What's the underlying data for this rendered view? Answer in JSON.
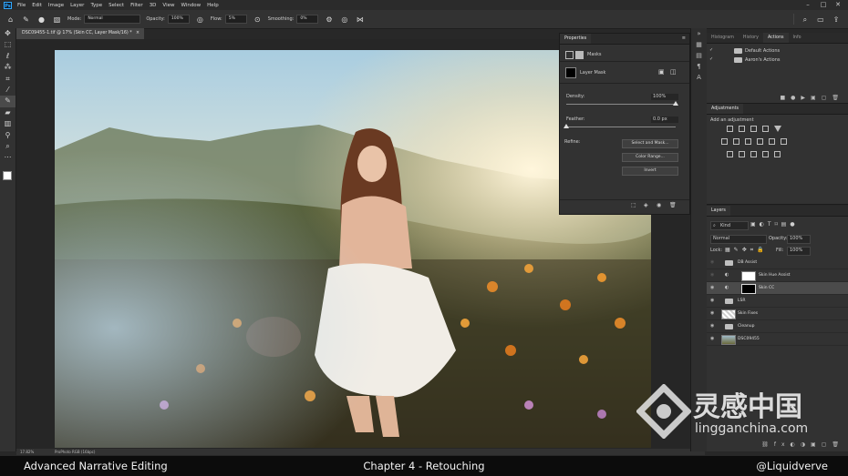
{
  "menubar": {
    "logo": "Ps",
    "items": [
      "File",
      "Edit",
      "Image",
      "Layer",
      "Type",
      "Select",
      "Filter",
      "3D",
      "View",
      "Window",
      "Help"
    ],
    "window_controls": [
      "–",
      "□",
      "✕"
    ]
  },
  "options": {
    "mode_label": "Mode:",
    "mode_value": "Normal",
    "opacity_label": "Opacity:",
    "opacity_value": "100%",
    "flow_label": "Flow:",
    "flow_value": "5%",
    "smoothing_label": "Smoothing:",
    "smoothing_value": "0%"
  },
  "document": {
    "tab_title": "DSC09455-1.tif @ 17% (Skin CC, Layer Mask/16) *",
    "zoom": "17.82%",
    "profile": "ProPhoto RGB (16bpc)"
  },
  "properties": {
    "tabs": [
      "Properties"
    ],
    "masks_label": "Masks",
    "layer_mask_label": "Layer Mask",
    "density_label": "Density:",
    "density_value": "100%",
    "density_fraction": 1.0,
    "feather_label": "Feather:",
    "feather_value": "0.0 px",
    "feather_fraction": 0.0,
    "refine_label": "Refine:",
    "buttons": [
      "Select and Mask...",
      "Color Range...",
      "Invert"
    ]
  },
  "actions_panel": {
    "tabs": [
      "Histogram",
      "History",
      "Actions",
      "Info"
    ],
    "active_tab": "Actions",
    "items": [
      "Default Actions",
      "Aaron's Actions"
    ]
  },
  "adjustments_panel": {
    "title": "Adjustments",
    "subtitle": "Add an adjustment"
  },
  "layers_panel": {
    "tab": "Layers",
    "filter_kind": "Kind",
    "blend_mode": "Normal",
    "opacity_label": "Opacity:",
    "opacity_value": "100%",
    "lock_label": "Lock:",
    "fill_label": "Fill:",
    "fill_value": "100%",
    "layers": [
      {
        "name": "DB Assist",
        "type": "folder"
      },
      {
        "name": "Skin Hue Assist",
        "type": "adjustment"
      },
      {
        "name": "Skin CC",
        "type": "adjustment",
        "selected": true
      },
      {
        "name": "LSR",
        "type": "folder"
      },
      {
        "name": "Skin Fixes",
        "type": "pixel"
      },
      {
        "name": "Cleanup",
        "type": "folder"
      },
      {
        "name": "DSC09455",
        "type": "photo"
      }
    ]
  },
  "caption": {
    "left": "Advanced Narrative Editing",
    "center": "Chapter 4 - Retouching",
    "right": "@Liquidverve"
  },
  "watermark": {
    "cn": "灵感中国",
    "url": "lingganchina.com"
  },
  "colors": {
    "app_bg": "#282828",
    "panel_bg": "#323232",
    "accent": "#31a8ff"
  }
}
